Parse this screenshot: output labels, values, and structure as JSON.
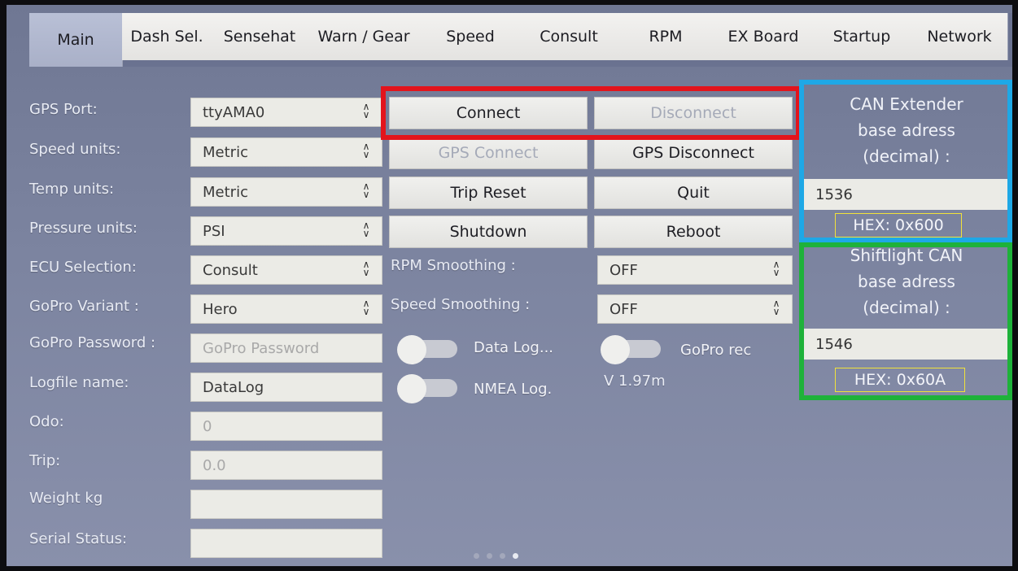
{
  "tabs": [
    "Main",
    "Dash Sel.",
    "Sensehat",
    "Warn / Gear",
    "Speed",
    "Consult",
    "RPM",
    "EX Board",
    "Startup",
    "Network"
  ],
  "settings": {
    "gps_port": {
      "label": "GPS Port:",
      "value": "ttyAMA0"
    },
    "speed_units": {
      "label": "Speed units:",
      "value": "Metric"
    },
    "temp_units": {
      "label": "Temp units:",
      "value": "Metric"
    },
    "pressure_units": {
      "label": "Pressure units:",
      "value": "PSI"
    },
    "ecu_selection": {
      "label": "ECU Selection:",
      "value": "Consult"
    },
    "gopro_variant": {
      "label": "GoPro Variant :",
      "value": "Hero"
    },
    "gopro_password": {
      "label": "GoPro Password :",
      "placeholder": "GoPro Password"
    },
    "logfile_name": {
      "label": "Logfile name:",
      "value": "DataLog"
    },
    "odo": {
      "label": "Odo:",
      "value": "0"
    },
    "trip": {
      "label": "Trip:",
      "value": "0.0"
    },
    "weight": {
      "label": "Weight kg",
      "value": ""
    },
    "serial_status": {
      "label": "Serial Status:",
      "value": ""
    }
  },
  "buttons": {
    "connect": "Connect",
    "disconnect": "Disconnect",
    "gps_connect": "GPS Connect",
    "gps_disconnect": "GPS Disconnect",
    "trip_reset": "Trip Reset",
    "quit": "Quit",
    "shutdown": "Shutdown",
    "reboot": "Reboot"
  },
  "smoothing": {
    "rpm": {
      "label": "RPM Smoothing :",
      "value": "OFF"
    },
    "speed": {
      "label": "Speed Smoothing :",
      "value": "OFF"
    }
  },
  "toggles": {
    "data_log": "Data Log...",
    "gopro_rec": "GoPro rec",
    "nmea_log": "NMEA Log."
  },
  "version": "V 1.97m",
  "can_extender": {
    "label_line1": "CAN Extender",
    "label_line2": "base adress",
    "label_line3": "(decimal) :",
    "value": "1536",
    "hex": "HEX: 0x600"
  },
  "shiftlight": {
    "label_line1": "Shiftlight CAN",
    "label_line2": "base adress",
    "label_line3": "(decimal) :",
    "value": "1546",
    "hex": "HEX: 0x60A"
  },
  "colors": {
    "highlight_red": "#e3141c",
    "highlight_blue": "#1ea8e6",
    "highlight_green": "#1eb23a",
    "hex_outline": "#f1e23a"
  },
  "page_indicator": {
    "count": 4,
    "active": 4
  }
}
